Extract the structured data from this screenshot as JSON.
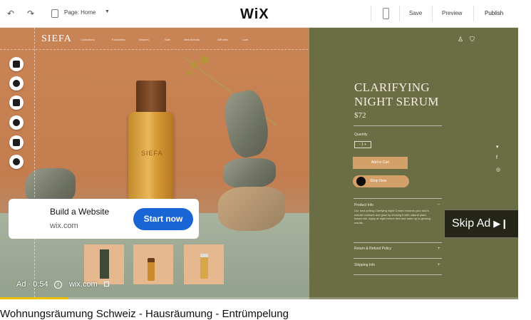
{
  "editor": {
    "page_label": "Page: Home",
    "logo": "WiX",
    "save_label": "Save",
    "preview_label": "Preview",
    "publish_label": "Publish"
  },
  "site": {
    "logo": "SIEFA",
    "nav": [
      "Collections",
      "Favourites",
      "Women",
      "Sale",
      "New Arrivals",
      "Gift sets",
      "Lore"
    ]
  },
  "product": {
    "name": "CLARIFYING NIGHT SERUM",
    "price": "$72",
    "bottle_label": "SIEFA",
    "quantity_label": "Quantity",
    "quantity_value": "- 1 +",
    "add_to_cart": "Add to Cart",
    "buy_now": "Shop Now",
    "info_label": "Product Info",
    "info_text": "Our best-selling Clarifying Night Cream restores your skin's natural moisture and glow by infusing it with natural plant-based oils. Apply at night before bed and wake up to glowing results.",
    "sections": [
      "Return & Refund Policy",
      "Shipping Info"
    ]
  },
  "ad": {
    "title": "Build a Website",
    "domain": "wix.com",
    "cta": "Start now",
    "skip_label": "Skip Ad",
    "timer": "Ad · 0:54",
    "link": "wix.com",
    "progress": 0.13
  },
  "video": {
    "title": "Wohnungsräumung Schweiz - Hausräumung - Entrümpelung"
  },
  "icons": {
    "undo": "undo-icon",
    "redo": "redo-icon",
    "info": "info-icon",
    "external_link": "external-link-icon",
    "skip": "skip-next-icon"
  },
  "colors": {
    "panel": "#6b6d44",
    "cta": "#1a65d6",
    "progress": "#f2c200"
  }
}
